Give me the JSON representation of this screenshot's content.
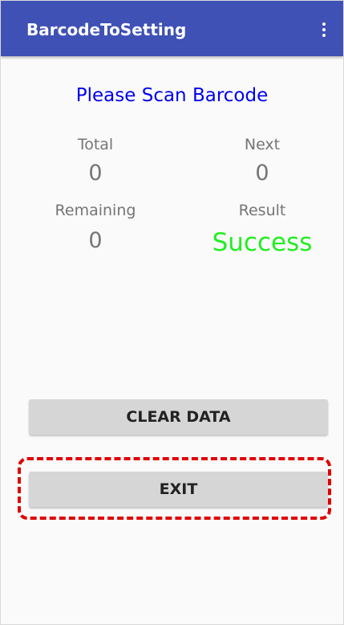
{
  "app_bar": {
    "title": "BarcodeToSetting",
    "menu_icon": "more-vert-icon"
  },
  "main": {
    "prompt": "Please Scan Barcode",
    "stats": {
      "total_label": "Total",
      "total_value": "0",
      "next_label": "Next",
      "next_value": "0",
      "remaining_label": "Remaining",
      "remaining_value": "0",
      "result_label": "Result",
      "result_value": "Success"
    },
    "buttons": {
      "clear_label": "CLEAR DATA",
      "exit_label": "EXIT"
    }
  },
  "colors": {
    "app_bar": "#3f51b5",
    "prompt": "#0000ee",
    "success": "#22ee22",
    "highlight": "#e00000"
  }
}
